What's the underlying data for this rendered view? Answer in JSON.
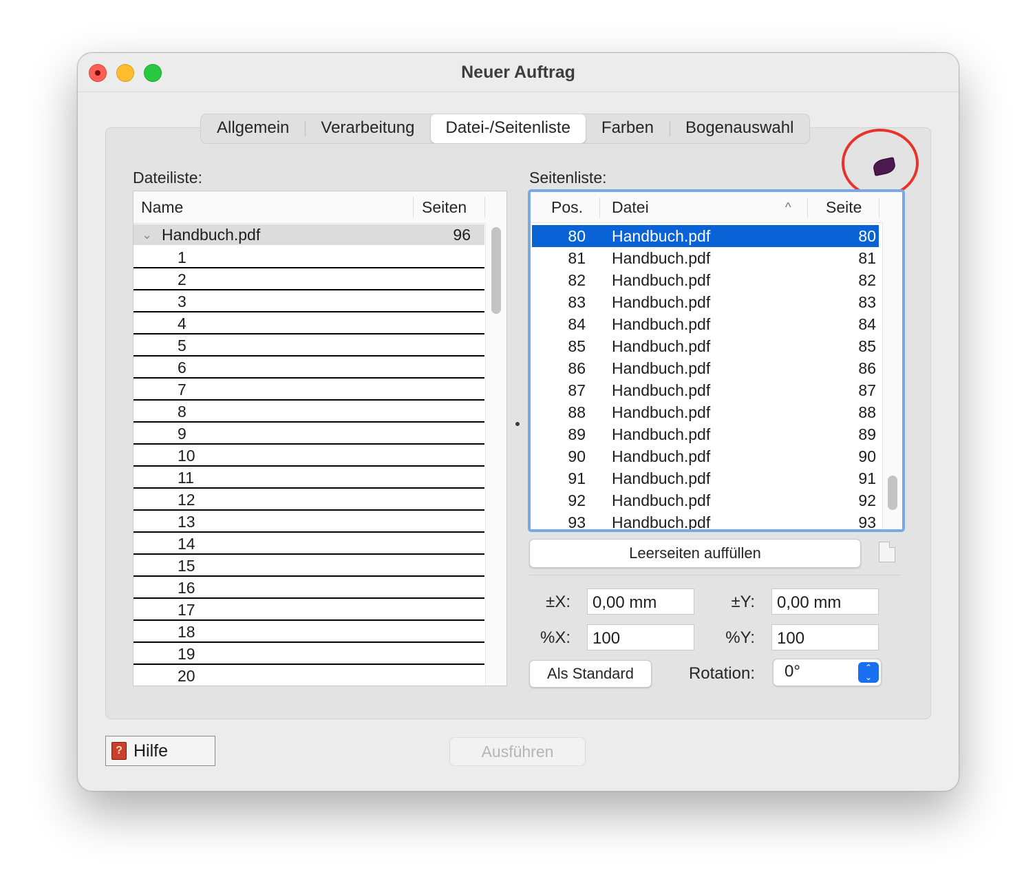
{
  "window": {
    "title": "Neuer Auftrag"
  },
  "tabs": [
    {
      "label": "Allgemein"
    },
    {
      "label": "Verarbeitung"
    },
    {
      "label": "Datei-/Seitenliste",
      "active": true
    },
    {
      "label": "Farben"
    },
    {
      "label": "Bogenauswahl"
    }
  ],
  "file_list": {
    "label": "Dateiliste:",
    "columns": {
      "name": "Name",
      "pages": "Seiten"
    },
    "root": {
      "name": "Handbuch.pdf",
      "pages": "96"
    },
    "rows": [
      "1",
      "2",
      "3",
      "4",
      "5",
      "6",
      "7",
      "8",
      "9",
      "10",
      "11",
      "12",
      "13",
      "14",
      "15",
      "16",
      "17",
      "18",
      "19",
      "20"
    ]
  },
  "page_list": {
    "label": "Seitenliste:",
    "columns": {
      "pos": "Pos.",
      "file": "Datei",
      "page": "Seite"
    },
    "rows": [
      {
        "pos": "80",
        "file": "Handbuch.pdf",
        "page": "80",
        "selected": true
      },
      {
        "pos": "81",
        "file": "Handbuch.pdf",
        "page": "81"
      },
      {
        "pos": "82",
        "file": "Handbuch.pdf",
        "page": "82"
      },
      {
        "pos": "83",
        "file": "Handbuch.pdf",
        "page": "83"
      },
      {
        "pos": "84",
        "file": "Handbuch.pdf",
        "page": "84"
      },
      {
        "pos": "85",
        "file": "Handbuch.pdf",
        "page": "85"
      },
      {
        "pos": "86",
        "file": "Handbuch.pdf",
        "page": "86"
      },
      {
        "pos": "87",
        "file": "Handbuch.pdf",
        "page": "87"
      },
      {
        "pos": "88",
        "file": "Handbuch.pdf",
        "page": "88"
      },
      {
        "pos": "89",
        "file": "Handbuch.pdf",
        "page": "89"
      },
      {
        "pos": "90",
        "file": "Handbuch.pdf",
        "page": "90"
      },
      {
        "pos": "91",
        "file": "Handbuch.pdf",
        "page": "91"
      },
      {
        "pos": "92",
        "file": "Handbuch.pdf",
        "page": "92"
      },
      {
        "pos": "93",
        "file": "Handbuch.pdf",
        "page": "93"
      }
    ]
  },
  "buttons": {
    "fill_blank": "Leerseiten auffüllen",
    "as_default": "Als Standard",
    "help": "Hilfe",
    "run": "Ausführen"
  },
  "fields": {
    "offset_x": {
      "label": "±X:",
      "value": "0,00 mm"
    },
    "offset_y": {
      "label": "±Y:",
      "value": "0,00 mm"
    },
    "scale_x": {
      "label": "%X:",
      "value": "100"
    },
    "scale_y": {
      "label": "%Y:",
      "value": "100"
    },
    "rotation": {
      "label": "Rotation:",
      "value": "0°"
    }
  },
  "icons": {
    "help_book": "help-book-icon",
    "leaf": "leaf-icon",
    "document": "document-icon",
    "sort": "sort-ascending-icon"
  },
  "colors": {
    "selection": "#0a63d6",
    "focus_ring": "#7aa7e6",
    "annotation": "#e8332b"
  }
}
